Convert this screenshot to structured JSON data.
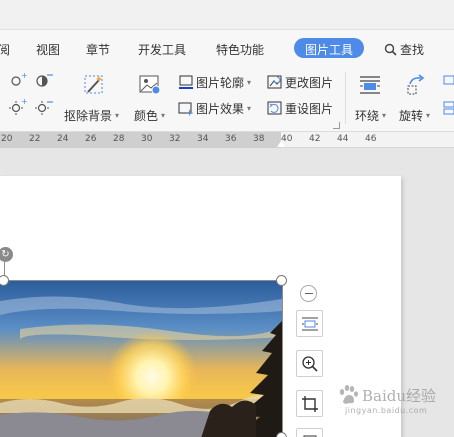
{
  "tabs": [
    {
      "label": "阅"
    },
    {
      "label": "视图"
    },
    {
      "label": "章节"
    },
    {
      "label": "开发工具"
    },
    {
      "label": "特色功能"
    },
    {
      "label": "图片工具",
      "active": true
    },
    {
      "label": "查找"
    }
  ],
  "ribbon": {
    "remove_bg": "抠除背景",
    "color": "颜色",
    "outline": "图片轮廓",
    "effect": "图片效果",
    "change_pic": "更改图片",
    "reset_pic": "重设图片",
    "wrap": "环绕",
    "rotate": "旋转"
  },
  "ruler": {
    "numbers": [
      "20",
      "22",
      "24",
      "26",
      "28",
      "30",
      "32",
      "34",
      "36",
      "38",
      "40",
      "42",
      "44",
      "46"
    ]
  },
  "watermark": {
    "text": "Baidu经验",
    "sub": "jingyan.baidu.com"
  },
  "colors": {
    "accent": "#4e8ae8",
    "ribbon_bg": "#f7f7f7",
    "canvas_bg": "#e6e6e6"
  }
}
